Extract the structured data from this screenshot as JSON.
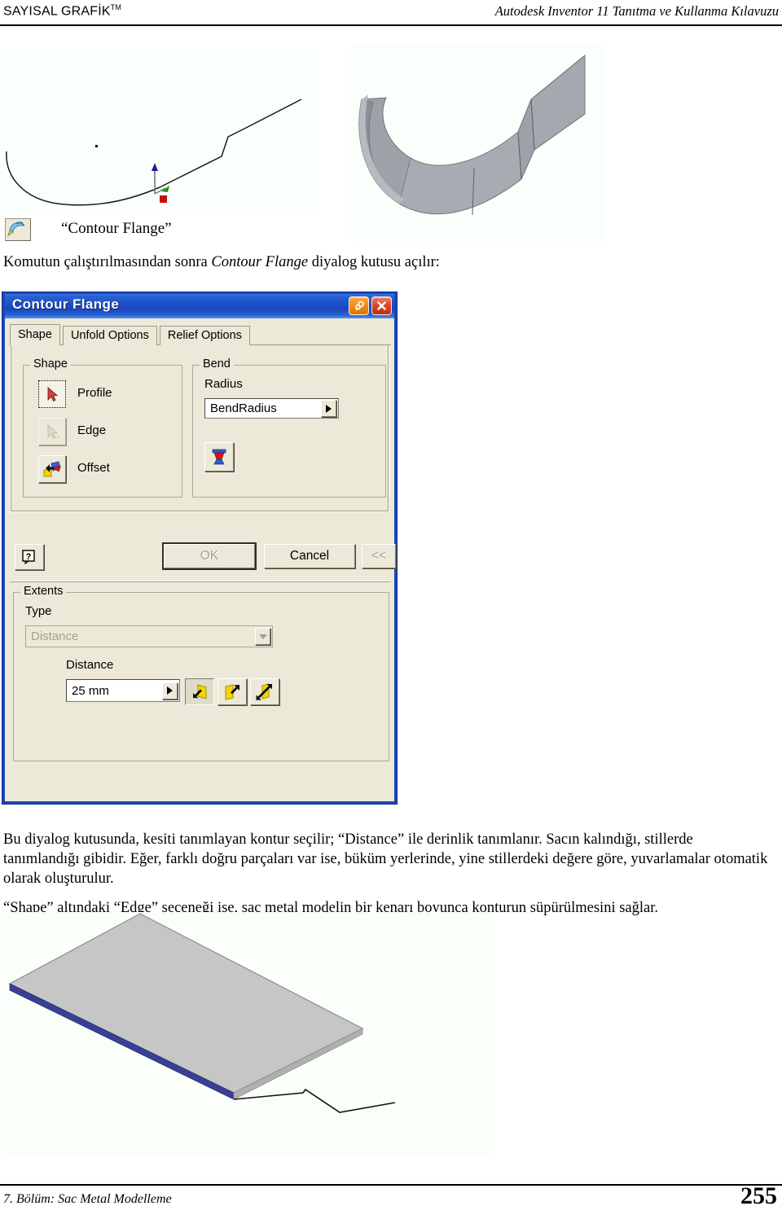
{
  "header": {
    "left_brand": "SAYISAL GRAFİK",
    "left_trademark": "TM",
    "right_title": "Autodesk Inventor 11 Tanıtma ve Kullanma Kılavuzu"
  },
  "figures": {
    "sketch_profile": "contour-profile-sketch",
    "solid_preview": "contour-flange-solid-model",
    "flat_plate": "sheet-metal-flat-plate-with-contour-sketch"
  },
  "command": {
    "icon": "contour-flange-icon",
    "caption": "“Contour Flange”",
    "intro_before": "Komutun çalıştırılmasından sonra ",
    "intro_italic": "Contour Flange",
    "intro_after": " diyalog kutusu açılır:"
  },
  "dialog": {
    "title": "Contour Flange",
    "titlebar_buttons": [
      {
        "name": "pin-button",
        "glyph": "pin-icon"
      },
      {
        "name": "close-button",
        "glyph": "close-icon"
      }
    ],
    "tabs": [
      {
        "label": "Shape",
        "active": true
      },
      {
        "label": "Unfold Options",
        "active": false
      },
      {
        "label": "Relief Options",
        "active": false
      }
    ],
    "shape_group": {
      "title": "Shape",
      "items": [
        {
          "label": "Profile",
          "icon": "select-profile-icon",
          "state": "focused"
        },
        {
          "label": "Edge",
          "icon": "select-edge-icon",
          "state": "disabled"
        },
        {
          "label": "Offset",
          "icon": "offset-direction-icon",
          "state": "enabled"
        }
      ]
    },
    "bend_group": {
      "title": "Bend",
      "radius_label": "Radius",
      "radius_value": "BendRadius",
      "bend_button_icon": "bend-shape-icon"
    },
    "buttons": {
      "help": "?",
      "ok": "OK",
      "cancel": "Cancel",
      "more": "<<"
    },
    "extents_group": {
      "title": "Extents",
      "type_label": "Type",
      "type_value": "Distance",
      "distance_label": "Distance",
      "distance_value": "25 mm",
      "direction_buttons": [
        {
          "name": "direction-one-side",
          "state": "pressed"
        },
        {
          "name": "direction-other-side",
          "state": "normal"
        },
        {
          "name": "direction-symmetric",
          "state": "normal"
        }
      ]
    },
    "colors": {
      "titlebar_blue": "#1d4fc6",
      "frame_blue": "#1b47b5",
      "face": "#ece9d8",
      "pin_orange": "#f08a16",
      "close_red": "#d94a31"
    }
  },
  "body": {
    "paragraph_1": "Bu diyalog kutusunda, kesiti tanımlayan kontur seçilir; “Distance” ile derinlik tanımlanır. Sacın kalındığı, stillerde tanımlandığı gibidir. Eğer, farklı doğru parçaları var ise, büküm yerlerinde, yine stillerdeki değere göre, yuvarlamalar otomatik olarak oluşturulur.",
    "paragraph_2": "“Shape” altındaki “Edge” seçeneği ise, sac metal modelin bir kenarı boyunca konturun süpürülmesini sağlar."
  },
  "footer": {
    "chapter": "7. Bölüm: Sac Metal Modelleme",
    "page_number": "255"
  }
}
